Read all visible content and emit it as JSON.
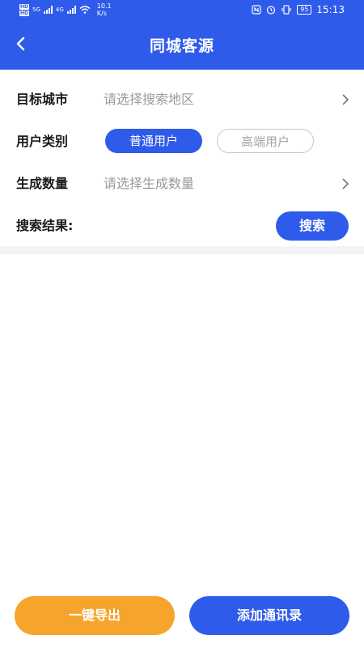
{
  "status_bar": {
    "hd1": "HD",
    "hd2": "HD",
    "net1": "5G",
    "net2": "4G",
    "speed_value": "10.1",
    "speed_unit": "K/s",
    "battery": "95",
    "time": "15:13"
  },
  "header": {
    "title": "同城客源"
  },
  "form": {
    "target_city_label": "目标城市",
    "target_city_placeholder": "请选择搜索地区",
    "user_type_label": "用户类别",
    "user_type_options": [
      "普通用户",
      "高端用户"
    ],
    "user_type_selected": "普通用户",
    "count_label": "生成数量",
    "count_placeholder": "请选择生成数量",
    "result_label": "搜索结果:",
    "search_button": "搜索"
  },
  "bottom": {
    "export_button": "一键导出",
    "add_contacts_button": "添加通讯录"
  },
  "colors": {
    "primary": "#2f5bea",
    "export": "#f7a42c"
  }
}
